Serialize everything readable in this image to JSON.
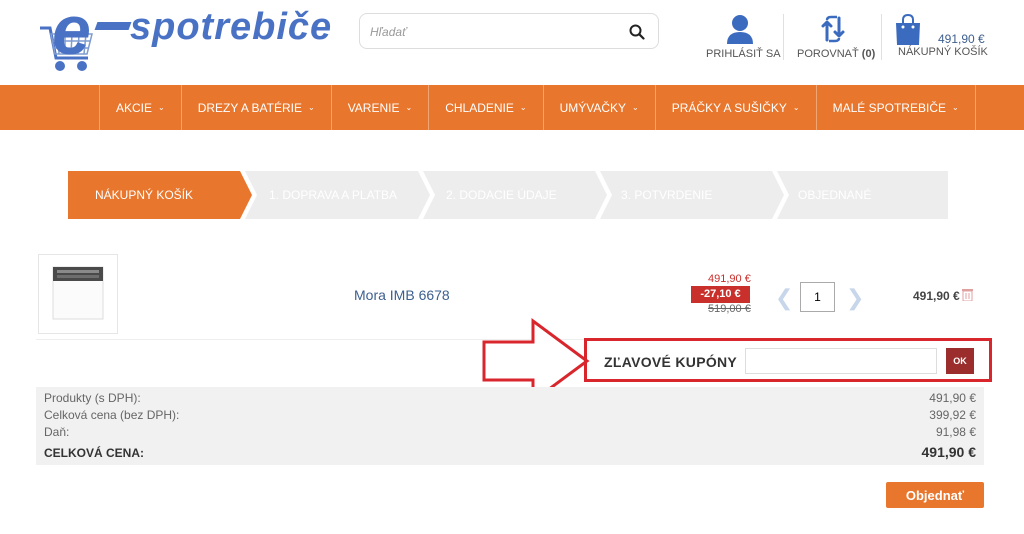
{
  "header": {
    "logo_text": "spotrebiče",
    "logo_letter": "e",
    "search_placeholder": "Hľadať",
    "login_label": "PRIHLÁSIŤ SA",
    "compare_label": "POROVNAŤ",
    "compare_count": "(0)",
    "cart_amount": "491,90 €",
    "cart_label": "NÁKUPNÝ KOŠÍK"
  },
  "nav": {
    "items": [
      {
        "label": "AKCIE"
      },
      {
        "label": "DREZY A BATÉRIE"
      },
      {
        "label": "VARENIE"
      },
      {
        "label": "CHLADENIE"
      },
      {
        "label": "UMÝVAČKY"
      },
      {
        "label": "PRÁČKY A SUŠIČKY"
      },
      {
        "label": "MALÉ SPOTREBIČE"
      }
    ]
  },
  "steps": [
    {
      "label": "NÁKUPNÝ KOŠÍK",
      "active": true
    },
    {
      "label": "1. DOPRAVA A PLATBA",
      "active": false
    },
    {
      "label": "2. DODACIE ÚDAJE",
      "active": false
    },
    {
      "label": "3. POTVRDENIE",
      "active": false
    },
    {
      "label": "OBJEDNANÉ",
      "active": false
    }
  ],
  "cart": {
    "product_name": "Mora IMB 6678",
    "price_new": "491,90 €",
    "discount": "-27,10 €",
    "price_original": "519,00 €",
    "quantity": "1",
    "row_total": "491,90 €"
  },
  "coupon": {
    "label": "ZĽAVOVÉ KUPÓNY",
    "button": "OK"
  },
  "summary": {
    "rows": [
      {
        "label": "Produkty (s DPH):",
        "value": "491,90 €"
      },
      {
        "label": "Celková cena (bez DPH):",
        "value": "399,92 €"
      },
      {
        "label": "Daň:",
        "value": "91,98 €"
      }
    ],
    "total_label": "CELKOVÁ CENA:",
    "total_value": "491,90 €"
  },
  "order_button": "Objednať",
  "colors": {
    "brand_orange": "#e8762c",
    "brand_blue": "#4a72c4",
    "alert_red": "#d9262c"
  }
}
